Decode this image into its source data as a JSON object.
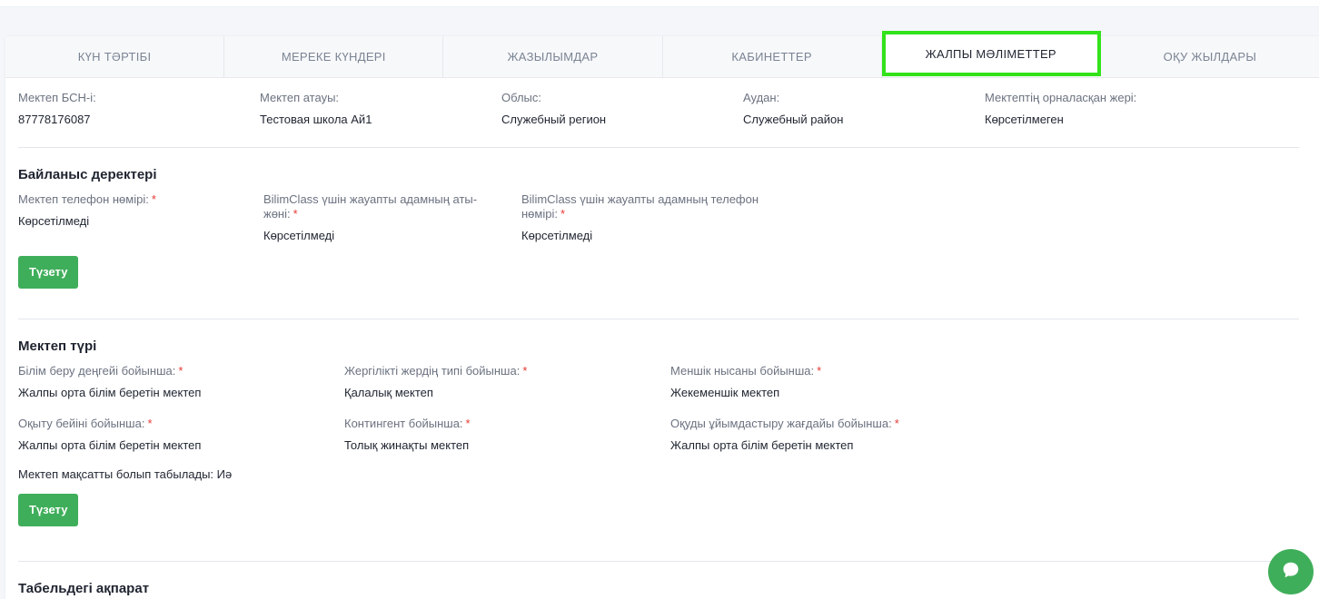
{
  "tabs": [
    {
      "label": "КҮН ТӘРТІБІ"
    },
    {
      "label": "МЕРЕКЕ КҮНДЕРІ"
    },
    {
      "label": "ЖАЗЫЛЫМДАР"
    },
    {
      "label": "КАБИНЕТТЕР"
    },
    {
      "label": "ЖАЛПЫ МӘЛІМЕТТЕР"
    },
    {
      "label": "ОҚУ ЖЫЛДАРЫ"
    }
  ],
  "general": [
    {
      "label": "Мектеп БСН-і:",
      "value": "87778176087"
    },
    {
      "label": "Мектеп атауы:",
      "value": "Тестовая школа Ай1"
    },
    {
      "label": "Облыс:",
      "value": "Служебный регион"
    },
    {
      "label": "Аудан:",
      "value": "Служебный район"
    },
    {
      "label": "Мектептің орналасқан жері:",
      "value": "Көрсетілмеген"
    }
  ],
  "contacts": {
    "title": "Байланыс деректері",
    "fields": [
      {
        "label": "Мектеп телефон нөмірі:",
        "required": "*",
        "value": "Көрсетілмеді"
      },
      {
        "label": "BilimClass үшін жауапты адамның аты-жөні:",
        "required": "*",
        "value": "Көрсетілмеді"
      },
      {
        "label": "BilimClass үшін жауапты адамның телефон нөмірі:",
        "required": "*",
        "value": "Көрсетілмеді"
      }
    ],
    "edit_label": "Түзету"
  },
  "school_type": {
    "title": "Мектеп түрі",
    "fields": [
      {
        "label": "Білім беру деңгейі бойынша:",
        "required": "*",
        "value": "Жалпы орта білім беретін мектеп"
      },
      {
        "label": "Жергілікті жердің типі бойынша:",
        "required": "*",
        "value": "Қалалық мектеп"
      },
      {
        "label": "Меншік нысаны бойынша:",
        "required": "*",
        "value": "Жекеменшік мектеп"
      },
      {
        "label": "Оқыту бейіні бойынша:",
        "required": "*",
        "value": "Жалпы орта білім беретін мектеп"
      },
      {
        "label": "Контингент бойынша:",
        "required": "*",
        "value": "Толық жинақты мектеп"
      },
      {
        "label": "Оқуды ұйымдастыру жағдайы бойынша:",
        "required": "*",
        "value": "Жалпы орта білім беретін мектеп"
      }
    ],
    "targeted": "Мектеп мақсатты болып табылады: Иә",
    "edit_label": "Түзету"
  },
  "tabel": {
    "title": "Табельдегі ақпарат"
  },
  "icons": {
    "chat": "chat-bubble-icon"
  },
  "colors": {
    "accent": "#3fae5a",
    "highlight": "#33e21b",
    "required": "#e53935"
  }
}
